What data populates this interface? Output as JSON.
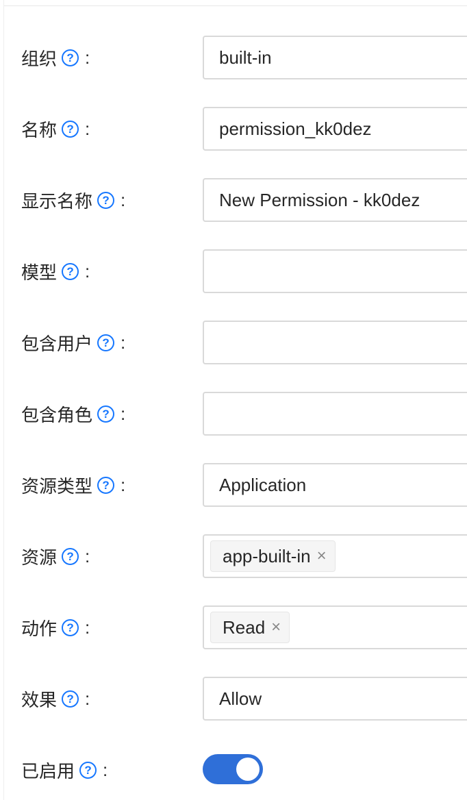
{
  "form": {
    "fields": [
      {
        "label": "组织",
        "value": "built-in"
      },
      {
        "label": "名称",
        "value": "permission_kk0dez"
      },
      {
        "label": "显示名称",
        "value": "New Permission - kk0dez"
      },
      {
        "label": "模型",
        "value": ""
      },
      {
        "label": "包含用户",
        "value": ""
      },
      {
        "label": "包含角色",
        "value": ""
      },
      {
        "label": "资源类型",
        "value": "Application"
      },
      {
        "label": "资源",
        "tag": "app-built-in"
      },
      {
        "label": "动作",
        "tag": "Read"
      },
      {
        "label": "效果",
        "value": "Allow"
      },
      {
        "label": "已启用",
        "enabled": true
      }
    ],
    "help_glyph": "?",
    "colon": ":",
    "tag_remove_glyph": "×"
  },
  "colors": {
    "accent": "#1677ff",
    "switch_on": "#2f6fd8",
    "border": "#d9d9d9"
  },
  "icons": {
    "help": "question-circle-icon",
    "remove": "close-icon"
  }
}
